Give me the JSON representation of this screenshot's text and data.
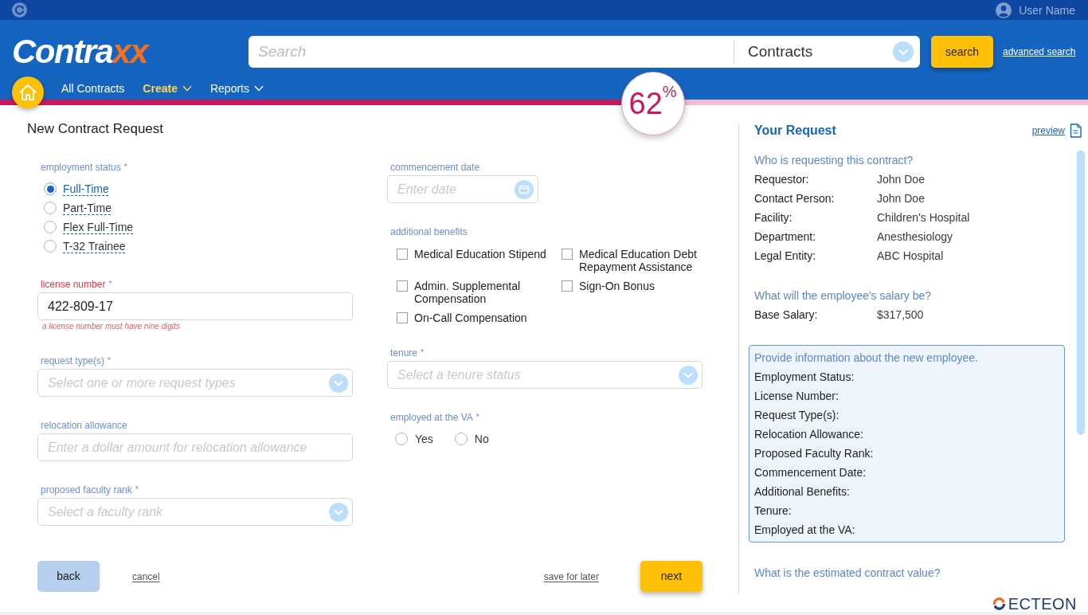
{
  "top_bar": {
    "user_name": "User Name"
  },
  "header": {
    "logo": {
      "text": "Contra",
      "accent": "xx"
    },
    "search": {
      "placeholder": "Search",
      "scope": "Contracts"
    },
    "search_button": "search",
    "advanced_search": "advanced search"
  },
  "nav": [
    {
      "label": "All Contracts",
      "selected": false,
      "menu": false
    },
    {
      "label": "Create",
      "selected": true,
      "menu": true
    },
    {
      "label": "Reports",
      "selected": false,
      "menu": true
    }
  ],
  "progress": {
    "level": 0.6,
    "reading": "62$^{%}$"
  },
  "form": {
    "title": "New Contract Request",
    "columns": [
      {
        "fields": [
          {
            "kind": "radio_list",
            "label": "employment status",
            "required_mark": "*",
            "invalid": false,
            "options": [
              {
                "label": "Full-Time",
                "selected": true
              },
              {
                "label": "Part-Time",
                "selected": false
              },
              {
                "label": "Flex Full-Time",
                "selected": false
              },
              {
                "label": "T-32 Trainee",
                "selected": false
              }
            ]
          },
          {
            "kind": "text",
            "label": "license number",
            "required_mark": "*",
            "invalid": true,
            "value": "422-809-17",
            "error_message": "a license number must have nine digits"
          },
          {
            "kind": "select",
            "label": "request type(s)",
            "required_mark": "*",
            "invalid": false,
            "placeholder": "Select one or more request types"
          },
          {
            "kind": "text",
            "label": "relocation allowance",
            "invalid": false,
            "placeholder": "Enter a dollar amount for relocation allowance"
          },
          {
            "kind": "select",
            "label": "proposed faculty rank",
            "required_mark": "*",
            "invalid": false,
            "placeholder": "Select a faculty rank"
          }
        ]
      },
      {
        "fields": [
          {
            "kind": "date",
            "label": "commencement date",
            "invalid": false,
            "placeholder": "Enter date"
          },
          {
            "kind": "checkbox_grid",
            "label": "additional benefits",
            "invalid": false,
            "options": [
              {
                "label": "Medical Education Stipend",
                "checked": false
              },
              {
                "label": "Medical Education Debt Repayment Assistance",
                "checked": false
              },
              {
                "label": "Admin. Supplemental Compensation",
                "checked": false
              },
              {
                "label": "Sign-On Bonus",
                "checked": false
              },
              {
                "label": "On-Call Compensation",
                "checked": false
              }
            ]
          },
          {
            "kind": "select",
            "label": "tenure",
            "required_mark": "*",
            "invalid": false,
            "placeholder": "Select a tenure status"
          },
          {
            "kind": "radio_row",
            "label": "employed at the VA",
            "required_mark": "*",
            "invalid": false,
            "options": [
              {
                "label": "Yes",
                "selected": false
              },
              {
                "label": "No",
                "selected": false
              }
            ]
          }
        ]
      }
    ],
    "actions": {
      "start": [
        {
          "label": "back",
          "kind": "secondary"
        },
        {
          "label": "cancel",
          "kind": "link"
        }
      ],
      "end": [
        {
          "label": "save for later",
          "kind": "link"
        },
        {
          "label": "next",
          "kind": "primary"
        }
      ]
    }
  },
  "summary": {
    "title": "Your Request",
    "preview": "preview",
    "sections": [
      {
        "heading": "Who is requesting this contract?",
        "highlighted": false,
        "rows": [
          {
            "label": "Requestor:",
            "value": "John Doe"
          },
          {
            "label": "Contact Person:",
            "value": "John Doe"
          },
          {
            "label": "Facility:",
            "value": "Children's Hospital"
          },
          {
            "label": "Department:",
            "value": "Anesthesiology"
          },
          {
            "label": "Legal Entity:",
            "value": "ABC Hospital"
          }
        ]
      },
      {
        "heading": "What will the employee's salary be?",
        "highlighted": false,
        "rows": [
          {
            "label": "Base Salary:",
            "value": "$317,500"
          }
        ]
      },
      {
        "heading": "Provide information about the new employee.",
        "highlighted": true,
        "rows": [
          {
            "label": "Employment Status:"
          },
          {
            "label": "License Number:"
          },
          {
            "label": "Request Type(s):"
          },
          {
            "label": "Relocation Allowance:"
          },
          {
            "label": "Proposed Faculty Rank:"
          },
          {
            "label": "Commencement Date:"
          },
          {
            "label": "Additional Benefits:"
          },
          {
            "label": "Tenure:"
          },
          {
            "label": "Employed at the VA:"
          }
        ]
      },
      {
        "heading": "What is the estimated contract value?",
        "highlighted": false
      }
    ]
  },
  "footer": {
    "brand": "ECTEON"
  }
}
